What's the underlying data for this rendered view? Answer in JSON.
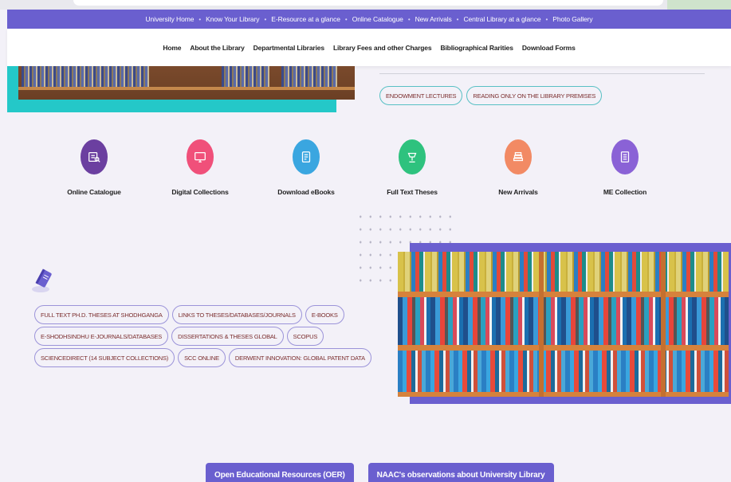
{
  "topbar": {
    "links": [
      "University Home",
      "Know Your Library",
      "E-Resource at a glance",
      "Online Catalogue",
      "New Arrivals",
      "Central Library at a glance",
      "Photo Gallery"
    ],
    "separator": "•"
  },
  "mainnav": {
    "items": [
      "Home",
      "About the Library",
      "Departmental Libraries",
      "Library Fees and other Charges",
      "Bibliographical Rarities",
      "Download Forms"
    ]
  },
  "top_tags": [
    "ENDOWMENT LECTURES",
    "READING ONLY ON THE LIBRARY PREMISES"
  ],
  "features": [
    {
      "label": "Online Catalogue",
      "icon": "catalogue-icon",
      "color": "#6b3fa0"
    },
    {
      "label": "Digital Collections",
      "icon": "monitor-icon",
      "color": "#f0507a"
    },
    {
      "label": "Download eBooks",
      "icon": "ebook-icon",
      "color": "#3aa6e0"
    },
    {
      "label": "Full Text Theses",
      "icon": "lamp-icon",
      "color": "#2ec27e"
    },
    {
      "label": "New Arrivals",
      "icon": "book-stack-icon",
      "color": "#f28a64"
    },
    {
      "label": "ME Collection",
      "icon": "document-icon",
      "color": "#8a62d6"
    }
  ],
  "resource_tags": [
    [
      "FULL TEXT PH.D. THESES AT SHODHGANGA",
      "LINKS TO THESES/DATABASES/JOURNALS",
      "E-BOOKS"
    ],
    [
      "E-SHODHSINDHU E-JOURNALS/DATABASES",
      "DISSERTATIONS & THESES GLOBAL",
      "SCOPUS"
    ],
    [
      "SCIENCEDIRECT (14 SUBJECT COLLECTIONS)",
      "SCC ONLINE",
      "DERWENT INNOVATION: GLOBAL PATENT DATA"
    ]
  ],
  "bottom_buttons": [
    "Open Educational Resources (OER)",
    "NAAC's observations about University Library"
  ],
  "colors": {
    "brand": "#6a5fcf",
    "accent_teal": "#24c8c8",
    "tag_text": "#7a2c2c"
  }
}
